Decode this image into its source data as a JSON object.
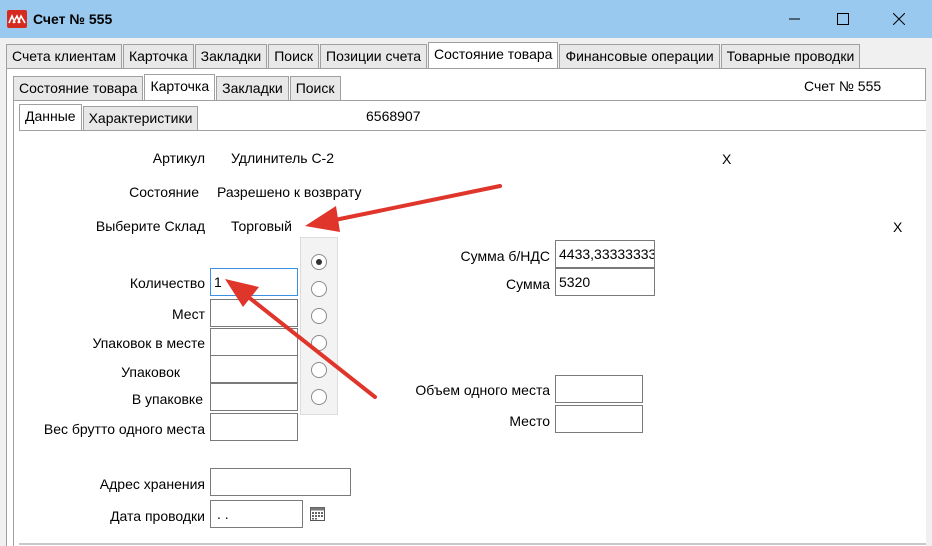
{
  "window": {
    "title": "Счет № 555"
  },
  "top_tabs": [
    {
      "label": "Счета клиентам"
    },
    {
      "label": "Карточка"
    },
    {
      "label": "Закладки"
    },
    {
      "label": "Поиск"
    },
    {
      "label": "Позиции счета"
    },
    {
      "label": "Состояние товара"
    },
    {
      "label": "Финансовые операции"
    },
    {
      "label": "Товарные проводки"
    }
  ],
  "sub_tabs": [
    {
      "label": "Состояние товара"
    },
    {
      "label": "Карточка"
    },
    {
      "label": "Закладки"
    },
    {
      "label": "Поиск"
    }
  ],
  "inner_tabs": [
    {
      "label": "Данные"
    },
    {
      "label": "Характеристики"
    }
  ],
  "header_invoice": "Счет № 555",
  "code_value": "6568907",
  "form": {
    "article_label": "Артикул",
    "article_value": "Удлинитель С-2",
    "article_clear": "X",
    "state_label": "Состояние",
    "state_value": "Разрешено к возврату",
    "warehouse_label": "Выберите Склад",
    "warehouse_value": "Торговый",
    "warehouse_clear": "X",
    "quantity_label": "Количество",
    "quantity_value": "1",
    "places_label": "Мест",
    "packs_per_place_label": "Упаковок в месте",
    "packs_label": "Упаковок",
    "per_pack_label": "В упаковке",
    "gross_weight_label": "Вес брутто одного места",
    "storage_address_label": "Адрес хранения",
    "posting_date_label": "Дата проводки",
    "posting_date_value": " .  .",
    "sum_no_vat_label": "Сумма  б/НДС",
    "sum_no_vat_value": "4433,33333333",
    "sum_label": "Сумма",
    "sum_value": "5320",
    "place_volume_label": "Объем одного места",
    "place_label": "Место"
  },
  "radios": [
    {
      "checked": true
    },
    {
      "checked": false
    },
    {
      "checked": false
    },
    {
      "checked": false
    },
    {
      "checked": false
    },
    {
      "checked": false
    }
  ],
  "colors": {
    "titlebar": "#99c9ef",
    "arrow": "#e0352b",
    "focus_border": "#3b8ee0"
  }
}
